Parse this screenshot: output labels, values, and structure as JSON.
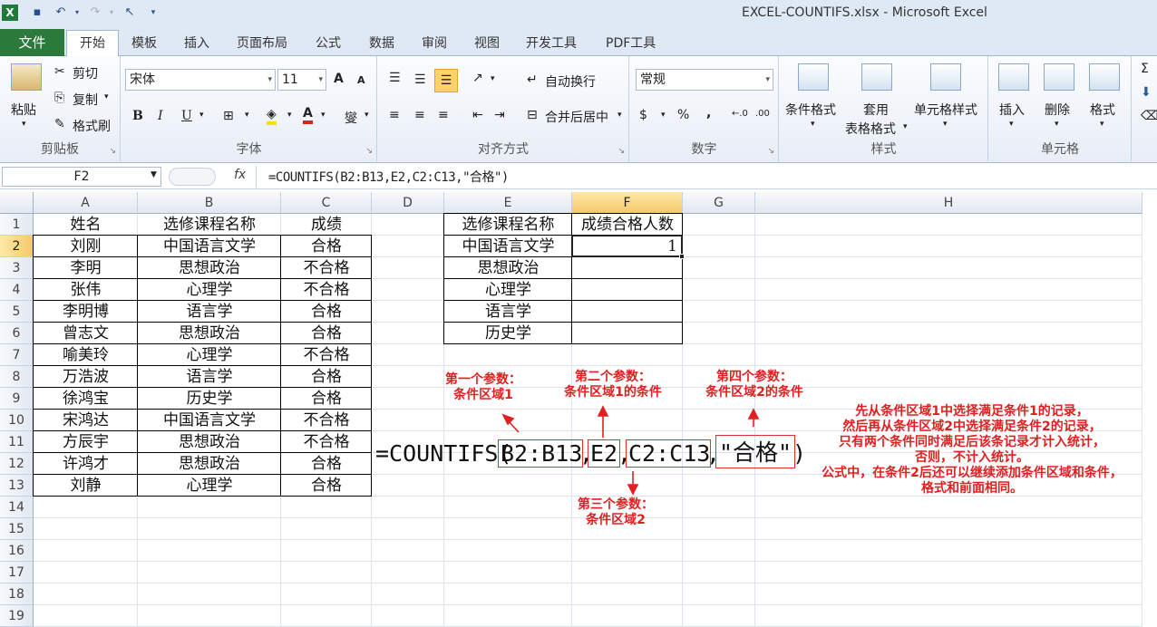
{
  "window": {
    "title": "EXCEL-COUNTIFS.xlsx  -  Microsoft Excel"
  },
  "tabs": {
    "file": "文件",
    "home": "开始",
    "template": "模板",
    "insert": "插入",
    "layout": "页面布局",
    "formulas": "公式",
    "data": "数据",
    "review": "审阅",
    "view": "视图",
    "dev": "开发工具",
    "pdf": "PDF工具"
  },
  "ribbon": {
    "clipboard": {
      "paste": "粘贴",
      "cut": "剪切",
      "copy": "复制",
      "painter": "格式刷",
      "label": "剪贴板"
    },
    "font": {
      "name": "宋体",
      "size": "11",
      "label": "字体",
      "bold": "B",
      "italic": "I",
      "underline": "U",
      "grow": "A",
      "shrink": "A"
    },
    "align": {
      "wrap": "自动换行",
      "merge": "合并后居中",
      "label": "对齐方式"
    },
    "number": {
      "format": "常规",
      "percent": "%",
      "comma": ",",
      "label": "数字"
    },
    "styles": {
      "cond": "条件格式",
      "table1": "套用",
      "table2": "表格格式",
      "cellstyle": "单元格样式",
      "label": "样式"
    },
    "cells": {
      "insert": "插入",
      "delete": "删除",
      "format": "格式",
      "label": "单元格"
    }
  },
  "formula_bar": {
    "name": "F2",
    "fx": "fx",
    "formula": "=COUNTIFS(B2:B13,E2,C2:C13,\"合格\")"
  },
  "columns": [
    "A",
    "B",
    "C",
    "D",
    "E",
    "F",
    "G",
    "H"
  ],
  "rows": [
    "1",
    "2",
    "3",
    "4",
    "5",
    "6",
    "7",
    "8",
    "9",
    "10",
    "11",
    "12",
    "13",
    "14",
    "15",
    "16",
    "17",
    "18",
    "19"
  ],
  "table_left": [
    [
      "姓名",
      "选修课程名称",
      "成绩"
    ],
    [
      "刘刚",
      "中国语言文学",
      "合格"
    ],
    [
      "李明",
      "思想政治",
      "不合格"
    ],
    [
      "张伟",
      "心理学",
      "不合格"
    ],
    [
      "李明博",
      "语言学",
      "合格"
    ],
    [
      "曾志文",
      "思想政治",
      "合格"
    ],
    [
      "喻美玲",
      "心理学",
      "不合格"
    ],
    [
      "万浩波",
      "语言学",
      "合格"
    ],
    [
      "徐鸿宝",
      "历史学",
      "合格"
    ],
    [
      "宋鸿达",
      "中国语言文学",
      "不合格"
    ],
    [
      "方辰宇",
      "思想政治",
      "不合格"
    ],
    [
      "许鸿才",
      "思想政治",
      "合格"
    ],
    [
      "刘静",
      "心理学",
      "合格"
    ]
  ],
  "table_right": [
    [
      "选修课程名称",
      "成绩合格人数"
    ],
    [
      "中国语言文学",
      "1"
    ],
    [
      "思想政治",
      ""
    ],
    [
      "心理学",
      ""
    ],
    [
      "语言学",
      ""
    ],
    [
      "历史学",
      ""
    ]
  ],
  "big_formula": {
    "prefix": "=COUNTIFS(",
    "p1": "B2:B13",
    ",": ",",
    "p2": "E2",
    "p3": "C2:C13",
    "p4": "\"合格\"",
    "suffix": ")"
  },
  "annotations": {
    "a1": "第一个参数：\n条件区域1",
    "a2": "第二个参数：\n条件区域1的条件",
    "a3": "第三个参数：\n条件区域2",
    "a4": "第四个参数：\n条件区域2的条件",
    "explain": "先从条件区域1中选择满足条件1的记录，\n然后再从条件区域2中选择满足条件2的记录，\n只有两个条件同时满足后该条记录才计入统计，\n否则，不计入统计。\n公式中，在条件2后还可以继续添加条件区域和条件，\n格式和前面相同。"
  }
}
